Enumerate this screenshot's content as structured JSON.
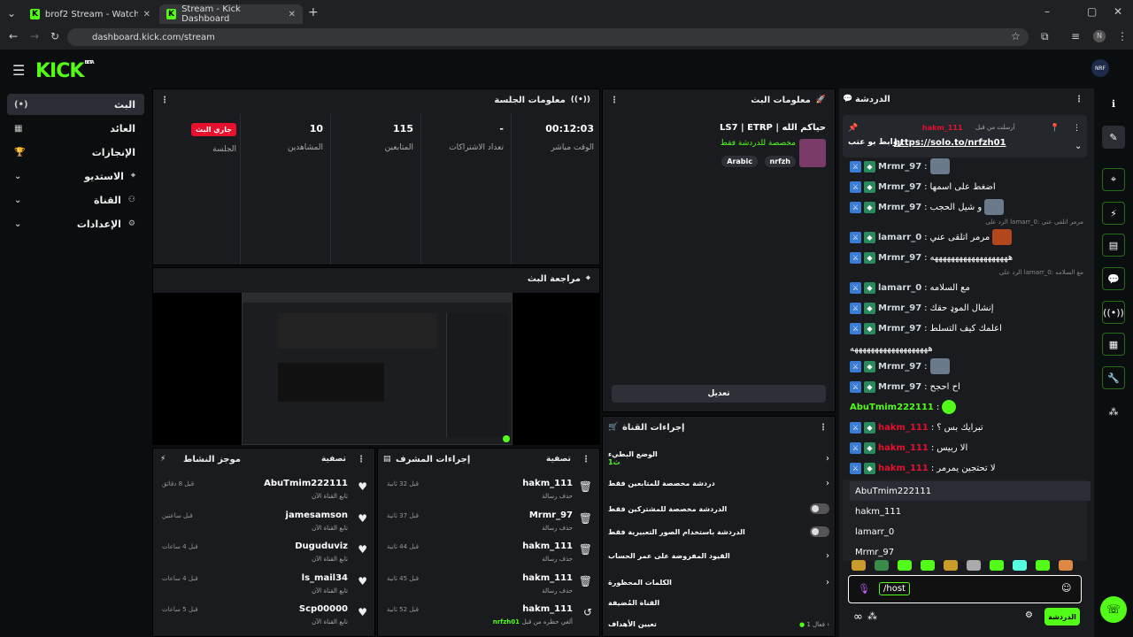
{
  "browser": {
    "tabs": [
      {
        "title": "brof2 Stream - Watch Live on K"
      },
      {
        "title": "Stream - Kick Dashboard"
      }
    ],
    "url": "dashboard.kick.com/stream",
    "profile_initial": "N"
  },
  "brand": {
    "logo": "KICK",
    "beta": "BETA",
    "accent": "#53fc18"
  },
  "nav": {
    "items": [
      {
        "label": "البث",
        "icon": "(•)"
      },
      {
        "label": "العائد",
        "icon": "▦"
      },
      {
        "label": "الإنجازات",
        "icon": "🏆"
      },
      {
        "label": "الاستديو",
        "icon": "⌄"
      },
      {
        "label": "القناة",
        "icon": "⌄"
      },
      {
        "label": "الإعدادات",
        "icon": "⌄"
      }
    ]
  },
  "session": {
    "title": "معلومات الجلسة",
    "stats": [
      {
        "value": "00:12:03",
        "label": "الوقت مباشر"
      },
      {
        "value": "-",
        "label": "تعداد الاشتراكات"
      },
      {
        "value": "115",
        "label": "المتابعين"
      },
      {
        "value": "10",
        "label": "المشاهدين"
      },
      {
        "value": "جاري البث",
        "label": "الجلسة"
      }
    ]
  },
  "stream_info": {
    "title": "معلومات البث",
    "stream_title": "LS7 | ETRP | حياكم الله",
    "category": "مخصصة للدردشة فقط",
    "tags": [
      "Arabic",
      "nrfzh"
    ],
    "edit_button": "تعديل"
  },
  "preview": {
    "title": "مراجعة البث"
  },
  "activity": {
    "title": "موجز النشاط",
    "filter": "تصفية",
    "items": [
      {
        "name": "AbuTmim222111",
        "sub": "تابع القناة الآن",
        "time": "قبل 8 دقائق"
      },
      {
        "name": "jamesamson",
        "sub": "تابع القناة الآن",
        "time": "قبل ساعتين"
      },
      {
        "name": "Duguduviz",
        "sub": "تابع القناة الآن",
        "time": "قبل 4 ساعات"
      },
      {
        "name": "ls_mail34",
        "sub": "تابع القناة الآن",
        "time": "قبل 4 ساعات"
      },
      {
        "name": "Scp00000",
        "sub": "تابع القناة الآن",
        "time": "قبل 5 ساعات"
      }
    ]
  },
  "mod_actions": {
    "title": "إجراءات المشرف",
    "filter": "تصفية",
    "items": [
      {
        "name": "hakm_111",
        "sub": "حذف رسالة",
        "time": "قبل 32 ثانية"
      },
      {
        "name": "Mrmr_97",
        "sub": "حذف رسالة",
        "time": "قبل 37 ثانية"
      },
      {
        "name": "hakm_111",
        "sub": "حذف رسالة",
        "time": "قبل 44 ثانية"
      },
      {
        "name": "hakm_111",
        "sub": "حذف رسالة",
        "time": "قبل 45 ثانية"
      },
      {
        "name": "hakm_111",
        "sub": "ألغي حظره من قبل",
        "extra": "nrfzh01",
        "time": "قبل 52 ثانية"
      }
    ]
  },
  "channel_actions": {
    "title": "إجراءات القناة",
    "slow_mode": "الوضع البطيء",
    "slow_mode_value": "1ث",
    "followers_only": "دردشة مخصصة للمتابعين فقط",
    "subscribers_only": "الدردشة مخصصة للمشتركين فقط",
    "emotes_only": "الدردشة باستخدام الصور التعبيرية فقط",
    "account_age": "القيود المفروضة على عمر الحساب",
    "banned_words": "الكلمات المحظورة",
    "hosted_channel": "القناة المُضيفة",
    "goals": "تعيين الأهداف",
    "goals_status": "فعال 1"
  },
  "chat": {
    "title": "الدردشة",
    "pinned": {
      "by_label": "أرسلت من قبل",
      "user": "hakm_111",
      "text": "روابط بو عتب",
      "link": "https://solo.to/nrfzh01"
    },
    "messages": [
      {
        "user": "Mrmr_97",
        "text": "",
        "emote": "img"
      },
      {
        "user": "Mrmr_97",
        "text": "اضغط على اسمها"
      },
      {
        "user": "Mrmr_97",
        "text": "و شيل الحجب",
        "emote": "img"
      },
      {
        "user": "lamarr_0",
        "text": "مرمر اتلقى عني",
        "emote": "fire",
        "reply": "الرد على lamarr_0: مرمر اتلقى عني"
      },
      {
        "user": "Mrmr_97",
        "text": "هههههههههههههههههههه"
      },
      {
        "user": "lamarr_0",
        "text": "مع السلامه",
        "reply": "الرد على lamarr_0: مع السلامه"
      },
      {
        "user": "Mrmr_97",
        "text": "إنشال الموډ حقك"
      },
      {
        "user": "Mrmr_97",
        "text": "اعلمك كيف التسلط",
        "cont": "هههههههههههههههههههه"
      },
      {
        "user": "Mrmr_97",
        "text": "",
        "emote": "img"
      },
      {
        "user": "Mrmr_97",
        "text": "اح احجح"
      },
      {
        "user": "AbuTmim222111",
        "text": "",
        "emote": "kick"
      },
      {
        "user": "hakm_111",
        "text": "تبرايك بس ؟"
      },
      {
        "user": "hakm_111",
        "text": "الا ربيس"
      },
      {
        "user": "hakm_111",
        "text": "لا تحتجين يمرمر"
      }
    ],
    "suggestions": [
      "AbuTmim222111",
      "hakm_111",
      "lamarr_0",
      "Mrmr_97"
    ],
    "input_value": "/host",
    "send_button": "الدردشة",
    "colors": {
      "mod": "#53fc18",
      "owner": "#e5112e",
      "normal": "#ffffff"
    }
  }
}
